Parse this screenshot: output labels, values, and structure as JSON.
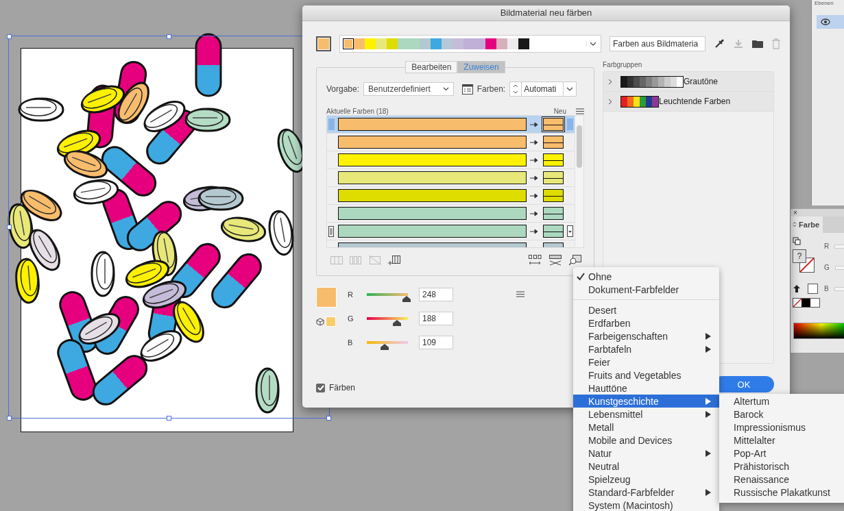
{
  "layers_panel": {
    "tab": "Ebenen"
  },
  "dialog": {
    "title": "Bildmaterial neu färben",
    "strip": [
      {
        "color": "#f8bc6d",
        "selected": true
      },
      {
        "color": "#f8bc6d",
        "selected": false
      },
      {
        "color": "#fff200",
        "selected": false
      },
      {
        "color": "#e8e87a",
        "selected": false
      },
      {
        "color": "#dfdc00",
        "selected": false
      },
      {
        "color": "#acd8bf",
        "selected": false
      },
      {
        "color": "#acd8bf",
        "selected": false
      },
      {
        "color": "#b4c8d0",
        "selected": false
      },
      {
        "color": "#3ea8e0",
        "selected": false
      },
      {
        "color": "#b4c8d8",
        "selected": false
      },
      {
        "color": "#c4bcd8",
        "selected": false
      },
      {
        "color": "#c0b0d8",
        "selected": false
      },
      {
        "color": "#c0b0d8",
        "selected": false
      },
      {
        "color": "#e6007e",
        "selected": false
      },
      {
        "color": "#d8b0bc",
        "selected": false
      },
      {
        "color": "#ececec",
        "selected": false
      },
      {
        "color": "#191919",
        "selected": false
      }
    ],
    "group_name_field": {
      "value": "Farben aus Bildmateria"
    },
    "tabs": [
      {
        "label": "Bearbeiten",
        "selected": false
      },
      {
        "label": "Zuweisen",
        "selected": true
      }
    ],
    "preset": {
      "label": "Vorgabe:",
      "value": "Benutzerdefiniert"
    },
    "colors_count": {
      "label": "Farben:",
      "value": "Automati"
    },
    "current_colors": {
      "title": "Aktuelle Farben (18)",
      "new_label": "Neu",
      "rows": [
        {
          "color": "#f8bc6d",
          "selected": true,
          "hovered": false
        },
        {
          "color": "#f8bc6d",
          "selected": false,
          "hovered": false
        },
        {
          "color": "#fff200",
          "selected": false,
          "hovered": false
        },
        {
          "color": "#e8e87a",
          "selected": false,
          "hovered": false
        },
        {
          "color": "#dfdc00",
          "selected": false,
          "hovered": false
        },
        {
          "color": "#acd8bf",
          "selected": false,
          "hovered": false
        },
        {
          "color": "#acd8bf",
          "selected": false,
          "hovered": true
        },
        {
          "color": "#b4c8d0",
          "selected": false,
          "hovered": false
        }
      ]
    },
    "current_color": {
      "color": "#f8bc6d"
    },
    "gamut_color": {
      "color": "#f9cd6a"
    },
    "sliders": [
      {
        "label": "R",
        "value": "248",
        "level": 0.97
      },
      {
        "label": "G",
        "value": "188",
        "level": 0.74
      },
      {
        "label": "B",
        "value": "109",
        "level": 0.43
      }
    ],
    "recolor_checkbox": {
      "label": "Färben",
      "checked": true
    },
    "color_groups": {
      "title": "Farbgruppen",
      "groups": [
        {
          "name": "Grautöne",
          "expanded": false,
          "swatches": [
            {
              "color": "#1a1a1a"
            },
            {
              "color": "#333333"
            },
            {
              "color": "#4d4d4d"
            },
            {
              "color": "#666666"
            },
            {
              "color": "#808080"
            },
            {
              "color": "#999999"
            },
            {
              "color": "#b3b3b3"
            },
            {
              "color": "#cccccc"
            },
            {
              "color": "#dcdcdc"
            },
            {
              "color": "#ffffff"
            }
          ]
        },
        {
          "name": "Leuchtende Farben",
          "expanded": false,
          "swatches": [
            {
              "color": "#e31e24"
            },
            {
              "color": "#ef6a1a"
            },
            {
              "color": "#fbe012"
            },
            {
              "color": "#2a9c3b"
            },
            {
              "color": "#233a8f"
            },
            {
              "color": "#8a3a96"
            }
          ]
        }
      ]
    },
    "ok_button": "OK"
  },
  "color_panel": {
    "close": "×",
    "tab": "Farbe",
    "unknown_mark": "?",
    "channels": [
      "R",
      "G",
      "B"
    ]
  },
  "menu": {
    "sections": [
      [
        {
          "label": "Ohne",
          "checked": true,
          "submenu": false,
          "selected": false
        },
        {
          "label": "Dokument-Farbfelder",
          "checked": false,
          "submenu": false,
          "selected": false
        }
      ],
      [
        {
          "label": "Desert",
          "checked": false,
          "submenu": false,
          "selected": false
        },
        {
          "label": "Erdfarben",
          "checked": false,
          "submenu": false,
          "selected": false
        },
        {
          "label": "Farbeigenschaften",
          "checked": false,
          "submenu": true,
          "selected": false
        },
        {
          "label": "Farbtafeln",
          "checked": false,
          "submenu": true,
          "selected": false
        },
        {
          "label": "Feier",
          "checked": false,
          "submenu": false,
          "selected": false
        },
        {
          "label": "Fruits and Vegetables",
          "checked": false,
          "submenu": false,
          "selected": false
        },
        {
          "label": "Hauttöne",
          "checked": false,
          "submenu": false,
          "selected": false
        },
        {
          "label": "Kunstgeschichte",
          "checked": false,
          "submenu": true,
          "selected": true
        },
        {
          "label": "Lebensmittel",
          "checked": false,
          "submenu": true,
          "selected": false
        },
        {
          "label": "Metall",
          "checked": false,
          "submenu": false,
          "selected": false
        },
        {
          "label": "Mobile and Devices",
          "checked": false,
          "submenu": false,
          "selected": false
        },
        {
          "label": "Natur",
          "checked": false,
          "submenu": true,
          "selected": false
        },
        {
          "label": "Neutral",
          "checked": false,
          "submenu": false,
          "selected": false
        },
        {
          "label": "Spielzeug",
          "checked": false,
          "submenu": false,
          "selected": false
        },
        {
          "label": "Standard-Farbfelder",
          "checked": false,
          "submenu": true,
          "selected": false
        },
        {
          "label": "System (Macintosh)",
          "checked": false,
          "submenu": false,
          "selected": false
        }
      ]
    ]
  },
  "submenu": {
    "items": [
      "Altertum",
      "Barock",
      "Impressionismus",
      "Mittelalter",
      "Pop-Art",
      "Prähistorisch",
      "Renaissance",
      "Russische Plakatkunst"
    ]
  }
}
